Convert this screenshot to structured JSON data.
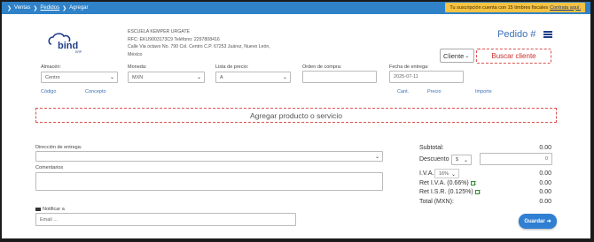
{
  "breadcrumb": {
    "items": [
      "Ventas",
      "Pedidos",
      "Agregar"
    ]
  },
  "subscription": {
    "text": "Tu suscripción cuenta con 15 timbres fiscales",
    "link": "Contrata aquí."
  },
  "company": {
    "logo_text": "bind",
    "logo_sub": "ERP",
    "name": "ESCUELA KEMPER URGATE",
    "rfc_line": "RFC: EKU9003173C9  Teléfono: 2297808416",
    "address_line": "Calle Via octavo No. 790 Col. Centro C.P. 67253 Juárez, Nuevo León,",
    "country": "México"
  },
  "header": {
    "title": "Pedido #",
    "client_select": "Cliente",
    "search_client": "Buscar cliente"
  },
  "form": {
    "almacen_label": "Almacén:",
    "almacen_value": "Centro",
    "moneda_label": "Moneda:",
    "moneda_value": "MXN",
    "lista_label": "Lista de precio:",
    "lista_value": "A",
    "orden_label": "Orden de compra:",
    "orden_value": "",
    "fecha_label": "Fecha de entrega:",
    "fecha_value": "2025-07-11"
  },
  "columns": {
    "codigo": "Código",
    "concepto": "Concepto",
    "cant": "Cant.",
    "precio": "Precio",
    "importe": "Importe"
  },
  "add_product": "Agregar producto o servicio",
  "delivery": {
    "label": "Dirección de entrega:"
  },
  "comments": {
    "label": "Comentarios"
  },
  "notify": {
    "label": "Notificar a",
    "placeholder": "Email ..."
  },
  "totals": {
    "subtotal_label": "Subtotal:",
    "subtotal": "0.00",
    "descuento_label": "Descuento",
    "descuento_unit": "$",
    "descuento_value": "0",
    "iva_label": "I.V.A.",
    "iva_rate": "16%",
    "iva": "0.00",
    "ret_iva_label": "Ret I.V.A. (0.66%)",
    "ret_iva": "0.00",
    "ret_isr_label": "Ret I.S.R. (0.125%)",
    "ret_isr": "0.00",
    "total_label": "Total (MXN):",
    "total": "0.00"
  },
  "actions": {
    "save": "Guardar"
  },
  "colors": {
    "topbar": "#2f82c8",
    "subscription_bg": "#f5c242",
    "accent_blue": "#3b6fb6",
    "danger": "#d9534f",
    "save_button": "#2f7fd3"
  }
}
